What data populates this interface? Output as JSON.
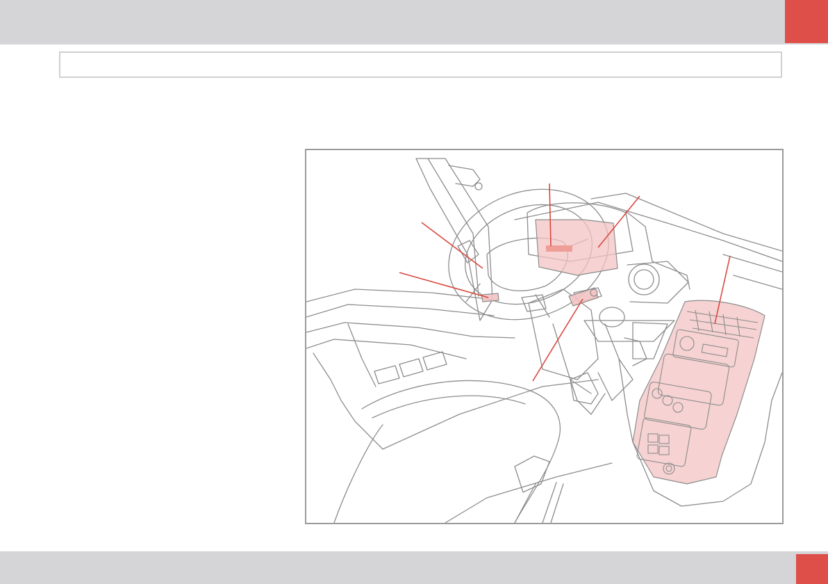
{
  "colors": {
    "bar": "#d5d5d7",
    "accent": "#df4f4a",
    "frame": "#9a9a9a",
    "header_border": "#d0d0d0",
    "highlight_fill": "#f3c3c3",
    "line_art": "#8c8c8c",
    "callout": "#d9473f"
  },
  "figure": {
    "icon": "vehicle-cockpit-illustration",
    "callout_count": 6
  }
}
